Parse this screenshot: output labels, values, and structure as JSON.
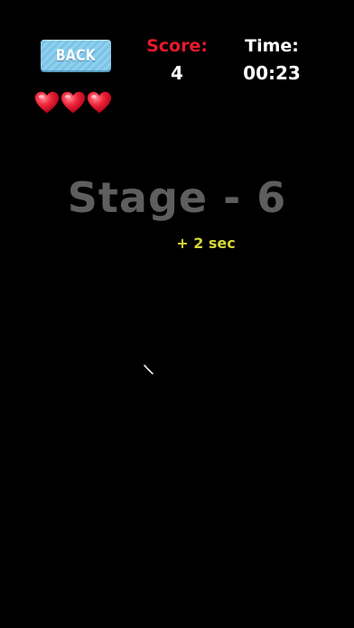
{
  "header": {
    "back_label": "BACK",
    "score_label": "Score:",
    "score_value": "4",
    "time_label": "Time:",
    "time_value": "00:23"
  },
  "lives": {
    "count": 3,
    "icon": "heart-icon",
    "color": "#e8192c"
  },
  "stage": {
    "title": "Stage - 6",
    "bonus": "+ 2 sec"
  },
  "colors": {
    "background": "#000000",
    "score_label": "#e8192c",
    "stage_text": "#5e5e5e",
    "bonus_text": "#d6d63a",
    "back_button": "#8fd0ee"
  }
}
